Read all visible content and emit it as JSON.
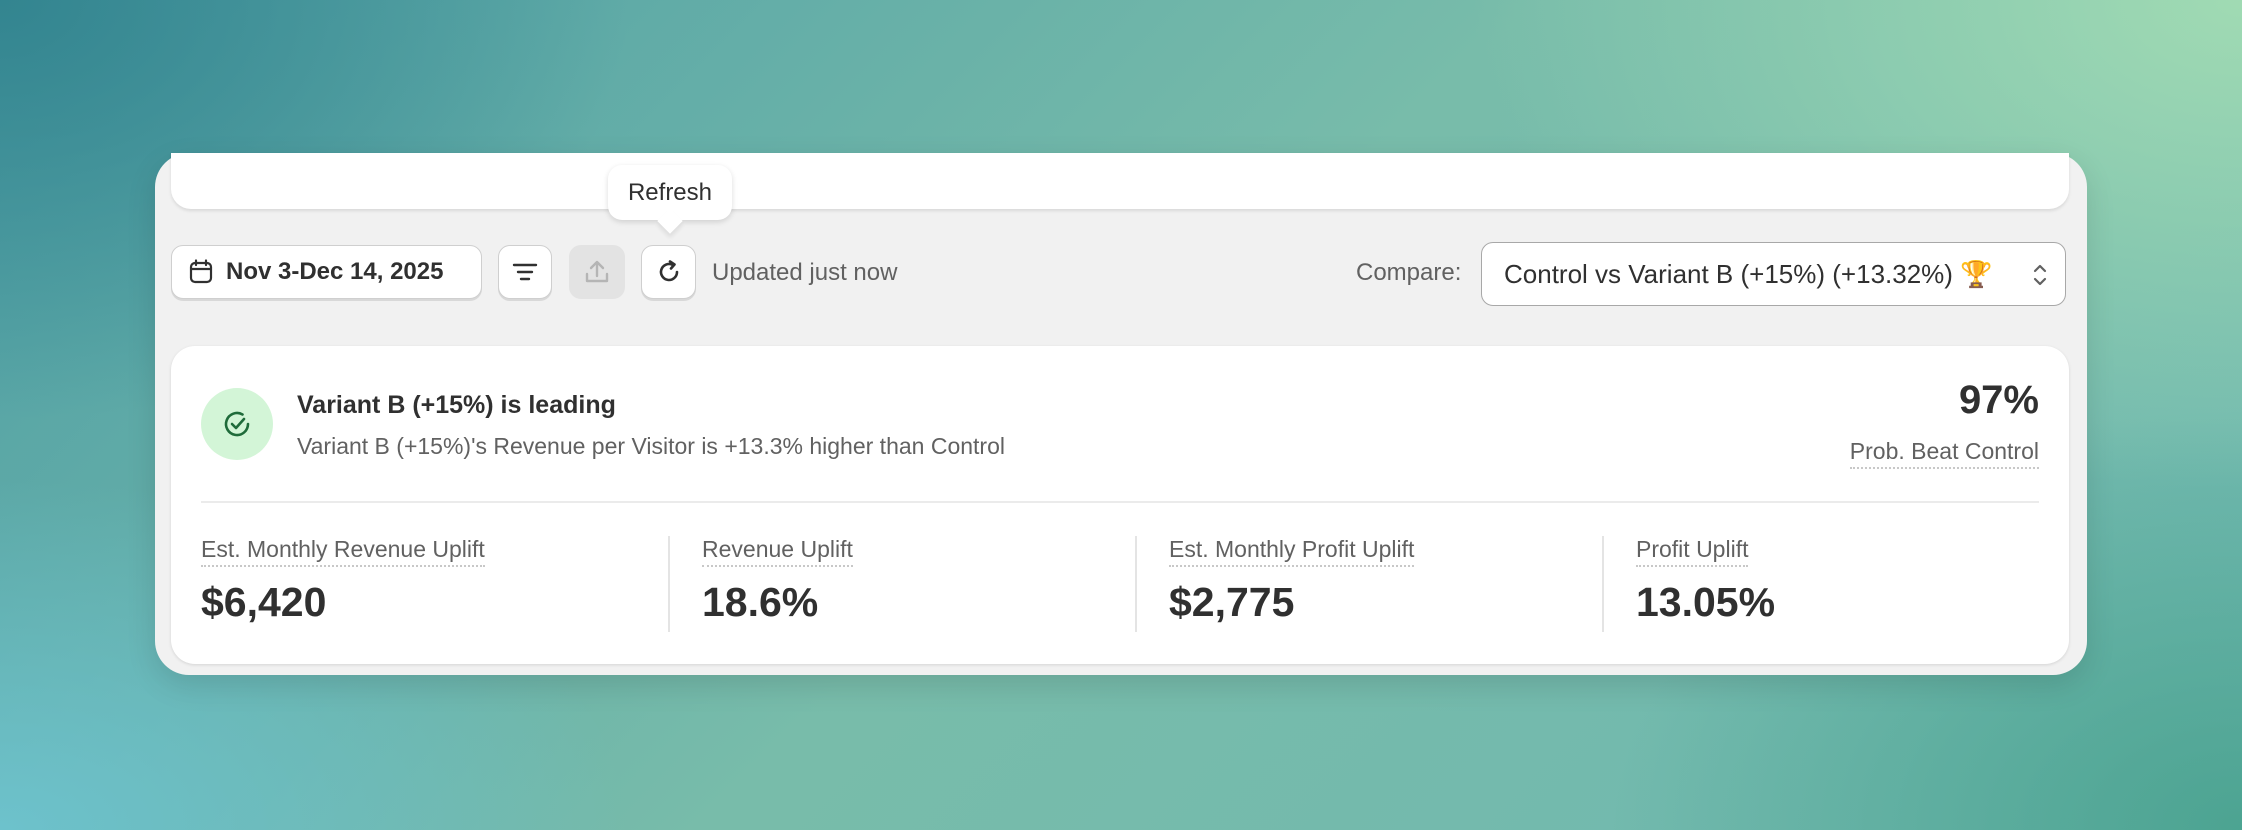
{
  "tooltip": {
    "text": "Refresh"
  },
  "toolbar": {
    "date_range": "Nov 3-Dec 14, 2025",
    "updated_text": "Updated just now",
    "compare_label": "Compare:",
    "compare_value": "Control vs Variant B (+15%) (+13.32%) 🏆",
    "icons": {
      "date": "calendar-icon",
      "filter": "filter-lines-icon",
      "export": "upload-icon",
      "refresh": "refresh-icon",
      "select": "chevron-up-down-icon"
    }
  },
  "summary": {
    "title": "Variant B (+15%) is leading",
    "subtitle": "Variant B (+15%)'s Revenue per Visitor is +13.3% higher than Control",
    "probability": "97%",
    "probability_label": "Prob. Beat Control",
    "icon": "check-circle-icon",
    "accent_color": "#d3f5d7"
  },
  "metrics": [
    {
      "label": "Est. Monthly Revenue Uplift",
      "value": "$6,420"
    },
    {
      "label": "Revenue Uplift",
      "value": "18.6%"
    },
    {
      "label": "Est. Monthly Profit Uplift",
      "value": "$2,775"
    },
    {
      "label": "Profit Uplift",
      "value": "13.05%"
    }
  ]
}
